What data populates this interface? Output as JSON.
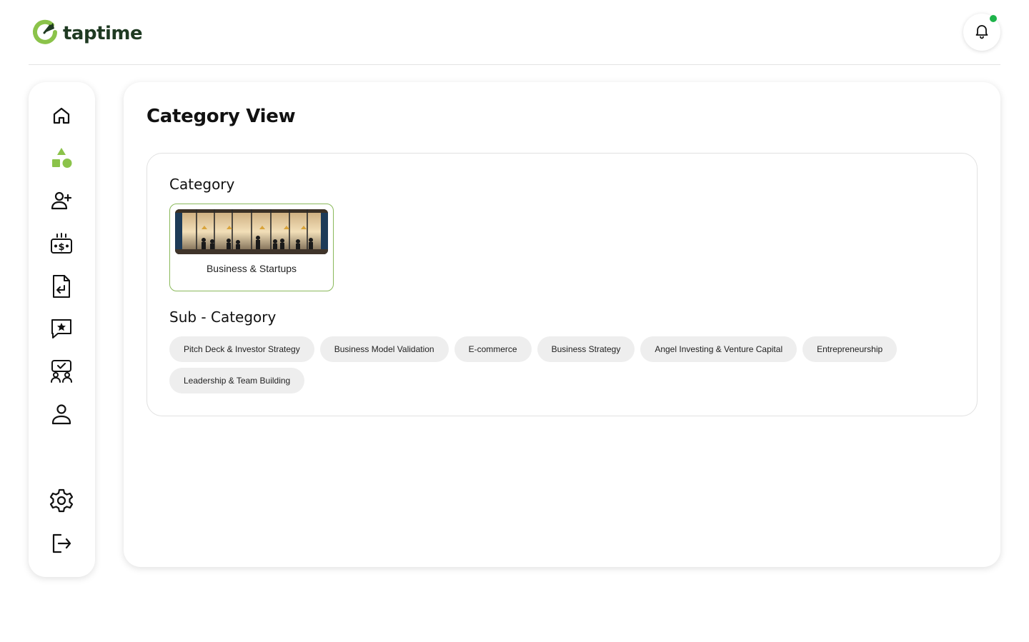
{
  "app": {
    "logo_text": "taptime",
    "brand_color": "#2e7d32",
    "accent_color": "#8bc34a",
    "notification_dot_color": "#1db34a"
  },
  "sidebar": {
    "items": [
      {
        "id": "home",
        "icon": "home-icon",
        "active": false
      },
      {
        "id": "categories",
        "icon": "shapes-icon",
        "active": true
      },
      {
        "id": "add-user",
        "icon": "add-user-icon",
        "active": false
      },
      {
        "id": "payments",
        "icon": "money-icon",
        "active": false
      },
      {
        "id": "documents",
        "icon": "document-return-icon",
        "active": false
      },
      {
        "id": "reviews",
        "icon": "star-message-icon",
        "active": false
      },
      {
        "id": "sessions",
        "icon": "group-check-icon",
        "active": false
      },
      {
        "id": "profile",
        "icon": "user-icon",
        "active": false
      }
    ],
    "bottom_items": [
      {
        "id": "settings",
        "icon": "gear-icon"
      },
      {
        "id": "logout",
        "icon": "logout-icon"
      }
    ]
  },
  "main": {
    "title": "Category View",
    "category_heading": "Category",
    "category": {
      "name": "Business & Startups",
      "image": "office-meeting-photo"
    },
    "subcategory_heading": "Sub - Category",
    "subcategories": [
      "Pitch Deck & Investor Strategy",
      "Business Model Validation",
      "E-commerce",
      "Business Strategy",
      "Angel Investing & Venture Capital",
      "Entrepreneurship",
      "Leadership & Team Building"
    ]
  }
}
